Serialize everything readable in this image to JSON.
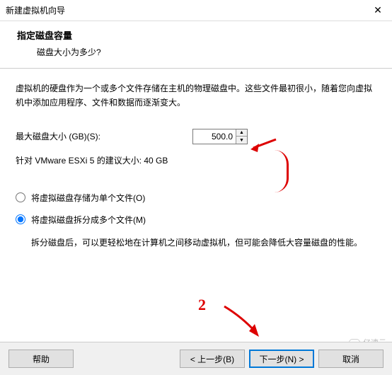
{
  "titlebar": {
    "title": "新建虚拟机向导"
  },
  "header": {
    "title": "指定磁盘容量",
    "subtitle": "磁盘大小为多少?"
  },
  "content": {
    "description": "虚拟机的硬盘作为一个或多个文件存储在主机的物理磁盘中。这些文件最初很小，随着您向虚拟机中添加应用程序、文件和数据而逐渐变大。",
    "size_label": "最大磁盘大小 (GB)(S):",
    "size_value": "500.0",
    "recommended": "针对 VMware ESXi 5 的建议大小: 40 GB",
    "radio_single": "将虚拟磁盘存储为单个文件(O)",
    "radio_split": "将虚拟磁盘拆分成多个文件(M)",
    "split_desc": "拆分磁盘后，可以更轻松地在计算机之间移动虚拟机，但可能会降低大容量磁盘的性能。"
  },
  "footer": {
    "help": "帮助",
    "back": "< 上一步(B)",
    "next": "下一步(N) >",
    "cancel": "取消"
  },
  "watermark": {
    "text": "亿速云"
  },
  "annotations": {
    "num2": "2"
  }
}
